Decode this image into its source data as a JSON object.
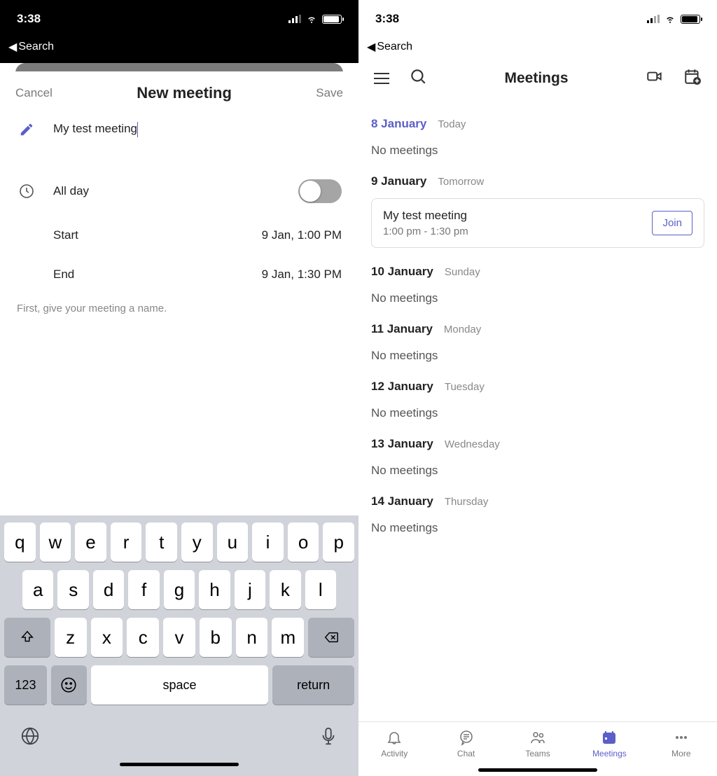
{
  "status": {
    "time": "3:38",
    "back_label": "Search"
  },
  "left": {
    "header": {
      "cancel": "Cancel",
      "title": "New meeting",
      "save": "Save"
    },
    "meeting_title": "My test meeting",
    "all_day_label": "All day",
    "all_day_on": false,
    "start_label": "Start",
    "start_value": "9 Jan, 1:00 PM",
    "end_label": "End",
    "end_value": "9 Jan, 1:30 PM",
    "hint": "First, give your meeting a name.",
    "keyboard": {
      "row1": [
        "q",
        "w",
        "e",
        "r",
        "t",
        "y",
        "u",
        "i",
        "o",
        "p"
      ],
      "row2": [
        "a",
        "s",
        "d",
        "f",
        "g",
        "h",
        "j",
        "k",
        "l"
      ],
      "row3": [
        "z",
        "x",
        "c",
        "v",
        "b",
        "n",
        "m"
      ],
      "num": "123",
      "space": "space",
      "return": "return"
    }
  },
  "right": {
    "title": "Meetings",
    "days": [
      {
        "date": "8 January",
        "tag": "Today",
        "today": true,
        "empty_text": "No meetings",
        "meetings": []
      },
      {
        "date": "9 January",
        "tag": "Tomorrow",
        "meetings": [
          {
            "title": "My test meeting",
            "time": "1:00 pm - 1:30 pm",
            "join": "Join"
          }
        ]
      },
      {
        "date": "10 January",
        "tag": "Sunday",
        "empty_text": "No meetings",
        "meetings": []
      },
      {
        "date": "11 January",
        "tag": "Monday",
        "empty_text": "No meetings",
        "meetings": []
      },
      {
        "date": "12 January",
        "tag": "Tuesday",
        "empty_text": "No meetings",
        "meetings": []
      },
      {
        "date": "13 January",
        "tag": "Wednesday",
        "empty_text": "No meetings",
        "meetings": []
      },
      {
        "date": "14 January",
        "tag": "Thursday",
        "empty_text": "No meetings",
        "meetings": []
      }
    ],
    "tabs": {
      "activity": "Activity",
      "chat": "Chat",
      "teams": "Teams",
      "meetings": "Meetings",
      "more": "More"
    }
  }
}
